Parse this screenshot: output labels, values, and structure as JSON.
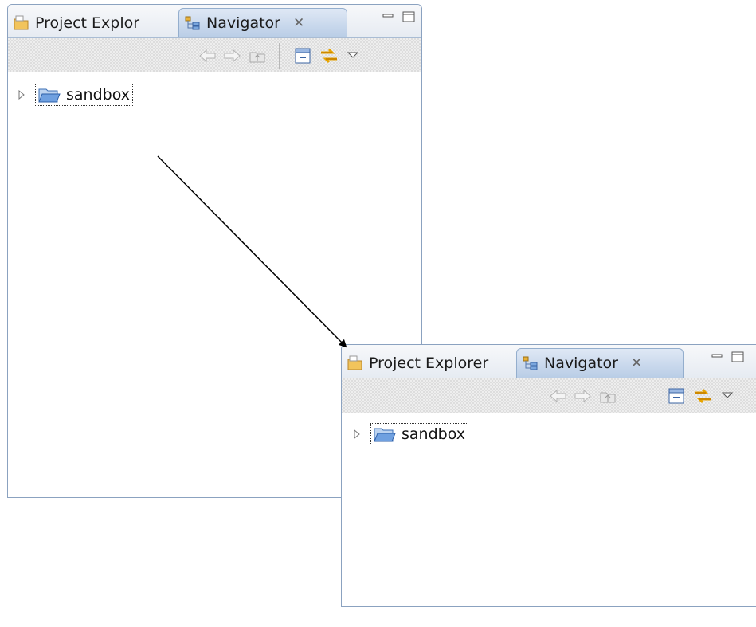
{
  "before": {
    "tabs": [
      {
        "label": "Project Explor",
        "icon": "project-explorer-icon",
        "active": false
      },
      {
        "label": "Navigator",
        "icon": "navigator-icon",
        "active": true
      }
    ],
    "close_glyph": "✕",
    "tree": [
      {
        "label": "sandbox",
        "icon": "open-folder-icon",
        "expanded": false
      }
    ]
  },
  "after": {
    "tabs": [
      {
        "label": "Project Explorer",
        "icon": "project-explorer-icon",
        "active": false
      },
      {
        "label": "Navigator",
        "icon": "navigator-icon",
        "active": true
      }
    ],
    "close_glyph": "✕",
    "tree": [
      {
        "label": "sandbox",
        "icon": "open-folder-icon",
        "expanded": false
      }
    ]
  },
  "toolbar_icons": [
    "back-arrow-icon",
    "forward-arrow-icon",
    "up-folder-icon",
    "collapse-all-icon",
    "link-with-editor-icon",
    "view-menu-icon"
  ],
  "colors": {
    "view_border": "#8ba2c0",
    "active_tab": "#c7d7ec",
    "link_icon": "#e8a400",
    "folder": "#5a8fd6"
  }
}
